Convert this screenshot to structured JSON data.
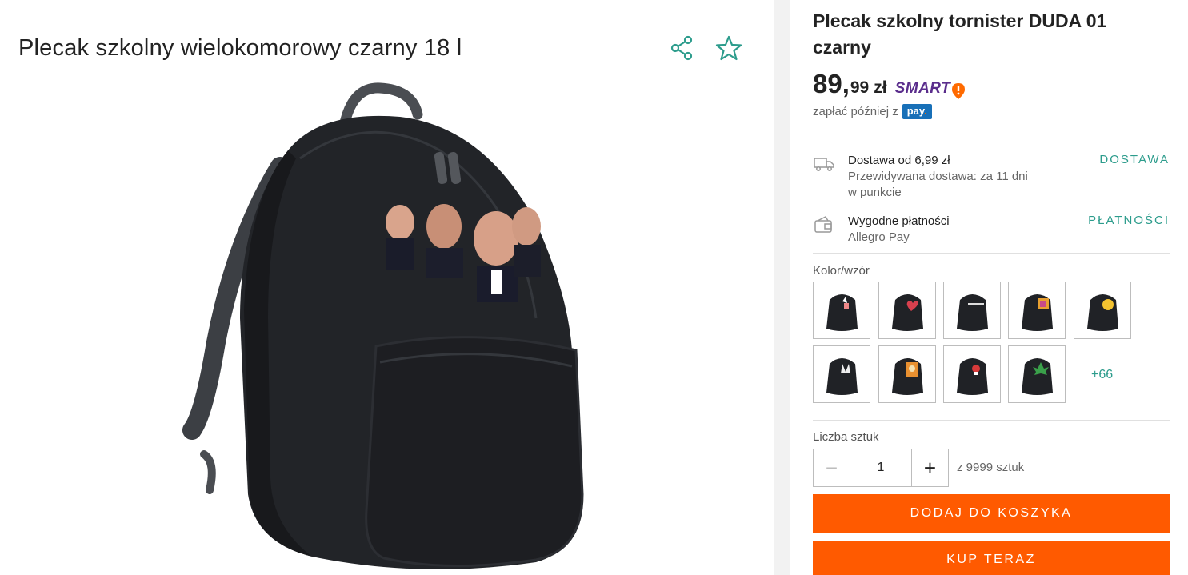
{
  "left": {
    "product_title": "Plecak szkolny wielokomorowy czarny 18 l",
    "share_icon": "share-icon",
    "favorite_icon": "star-outline-icon",
    "image_alt": "black backpack with printed faces"
  },
  "right": {
    "title": "Plecak szkolny tornister DUDA 01 czarny",
    "price": {
      "integer": "89,",
      "decimal": "99",
      "currency": "zł",
      "smart_label": "SMART"
    },
    "pay_later_text": "zapłać później z",
    "pay_logo": "pay",
    "delivery": {
      "line1": "Dostawa od 6,99 zł",
      "line2": "Przewidywana dostawa: za 11 dni",
      "line3": "w punkcie",
      "link": "DOSTAWA",
      "icon": "truck-icon"
    },
    "payment": {
      "line1": "Wygodne płatności",
      "line2": "Allegro Pay",
      "link": "PŁATNOŚCI",
      "icon": "wallet-icon"
    },
    "color_label": "Kolor/wzór",
    "swatches_more": "+66",
    "qty_label": "Liczba sztuk",
    "qty_value": "1",
    "qty_max": "z 9999 sztuk",
    "btn_cart": "DODAJ DO KOSZYKA",
    "btn_buy": "KUP TERAZ"
  },
  "colors": {
    "accent_teal": "#2c9c8c",
    "button_orange": "#ff5a00",
    "smart_purple": "#5a2d8c",
    "pay_blue": "#1870b8"
  }
}
